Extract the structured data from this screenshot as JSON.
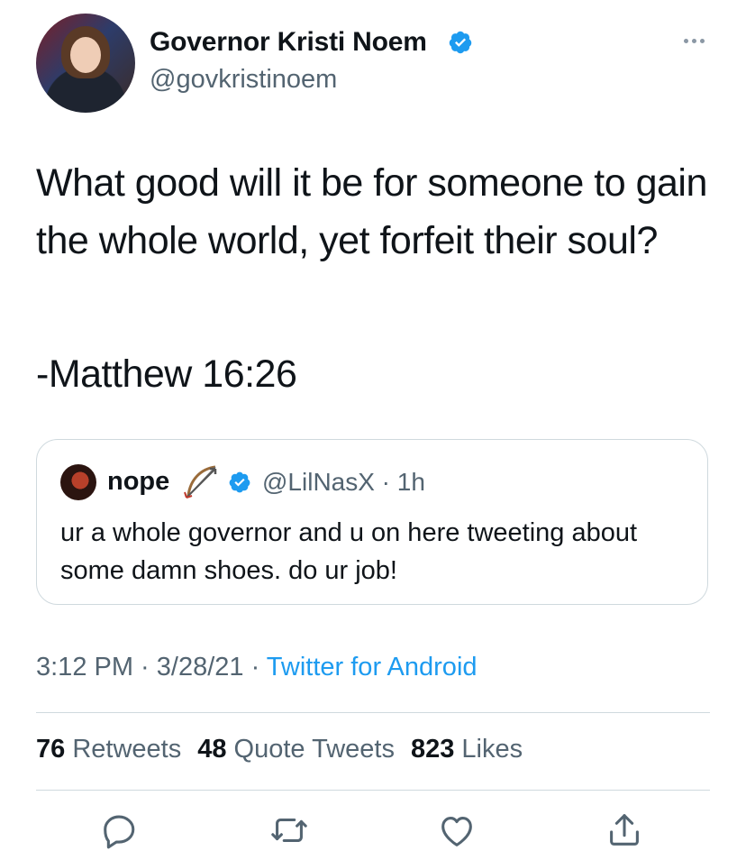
{
  "author": {
    "display_name": "Governor Kristi Noem",
    "handle": "@govkristinoem"
  },
  "tweet": {
    "text": "What good will it be for someone to gain the whole world, yet forfeit their soul?",
    "citation": "-Matthew 16:26"
  },
  "quote": {
    "display_name": "nope",
    "handle_time": "@LilNasX · 1h",
    "text": "ur a whole governor and u on here tweeting about some damn shoes. do ur job!"
  },
  "meta": {
    "time": "3:12 PM",
    "date": "3/28/21",
    "separator": " · ",
    "source": "Twitter for Android"
  },
  "stats": {
    "retweets_count": "76",
    "retweets_label": "Retweets",
    "quotes_count": "48",
    "quotes_label": "Quote Tweets",
    "likes_count": "823",
    "likes_label": "Likes"
  },
  "colors": {
    "accent": "#1d9bf0",
    "secondary_text": "#536471",
    "border": "#cfd9de"
  },
  "icons": {
    "more": "more-dots-icon",
    "verified": "verified-badge-icon",
    "reply": "reply-icon",
    "retweet": "retweet-icon",
    "like": "heart-icon",
    "share": "share-icon"
  }
}
